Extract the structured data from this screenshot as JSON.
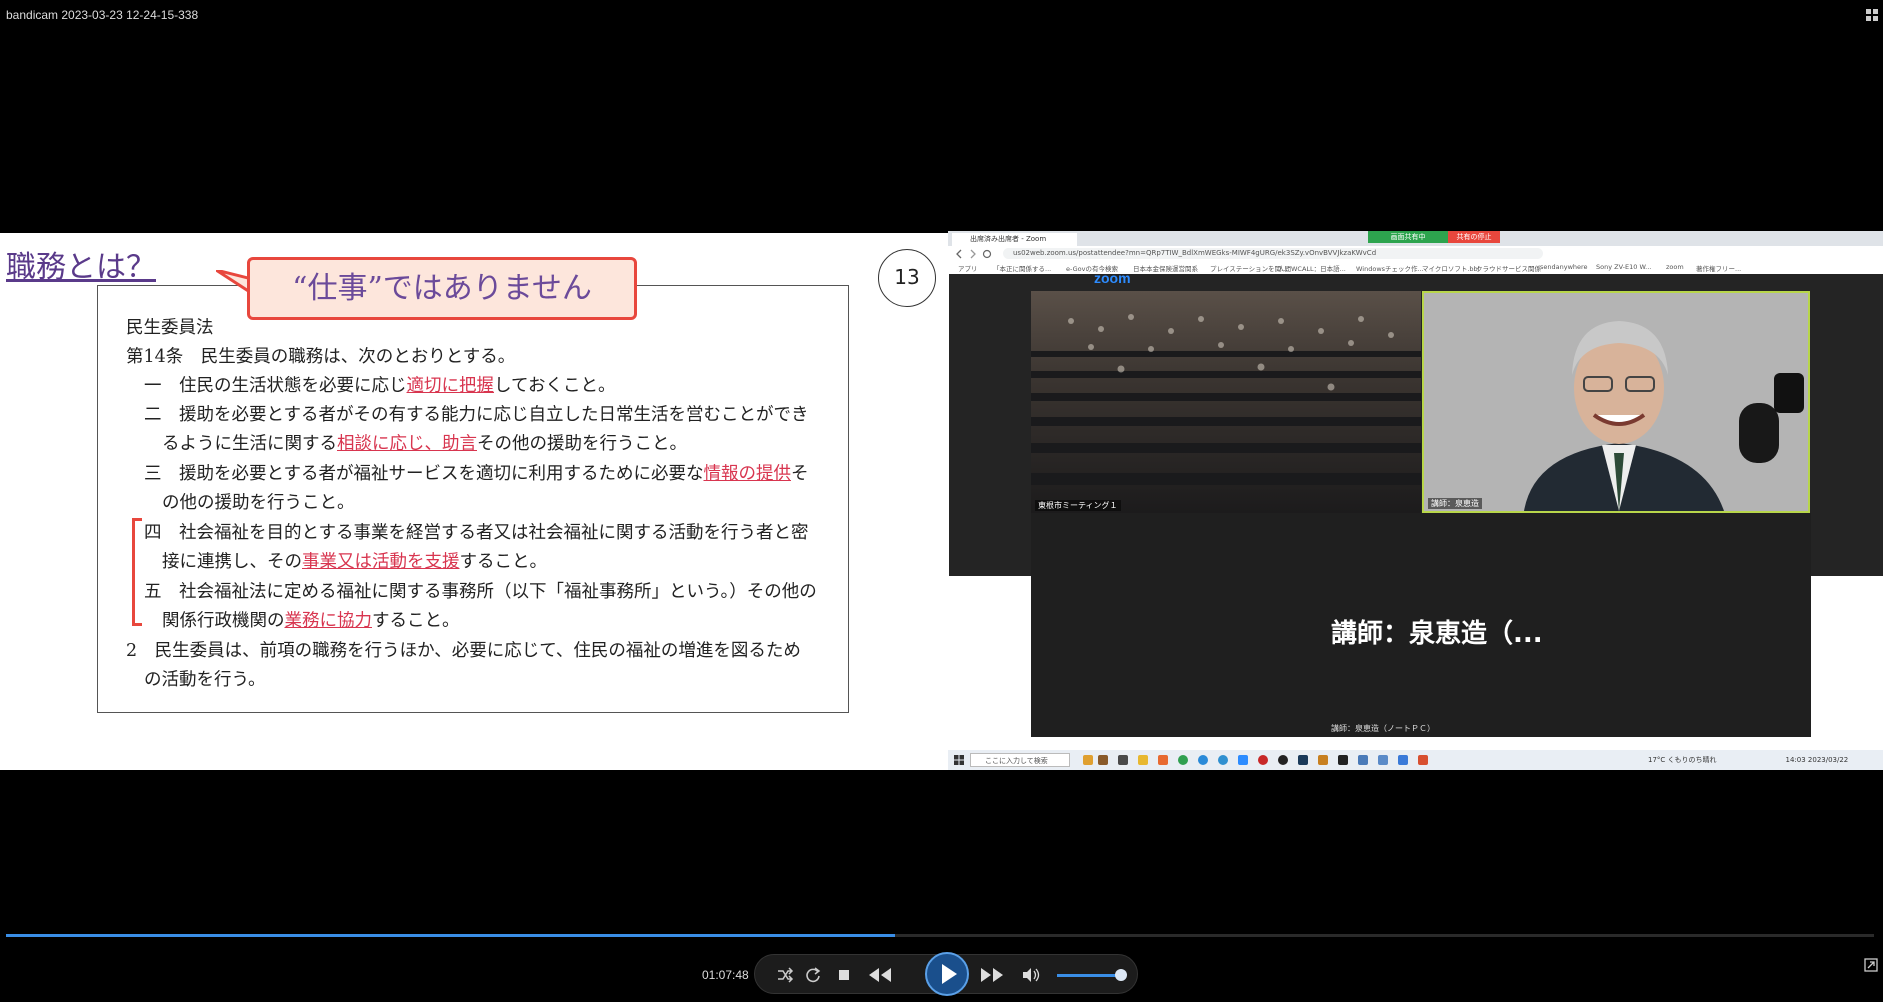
{
  "window": {
    "title": "bandicam 2023-03-23 12-24-15-338"
  },
  "slide": {
    "title": "職務とは？",
    "callout": "“仕事”ではありません",
    "page_number": "13",
    "law": {
      "name": "民生委員法",
      "article": "第14条　民生委員の職務は、次のとおりとする。",
      "item1_pre": "一　住民の生活状態を必要に応じ",
      "item1_hl": "適切に把握",
      "item1_post": "しておくこと。",
      "item2_line1": "二　援助を必要とする者がその有する能力に応じ自立した日常生活を営むことができ",
      "item2_pre": "るように生活に関する",
      "item2_hl": "相談に応じ、助言",
      "item2_post": "その他の援助を行うこと。",
      "item3_pre": "三　援助を必要とする者が福祉サービスを適切に利用するために必要な",
      "item3_hl": "情報の提供",
      "item3_post": "そ",
      "item3_line2": "の他の援助を行うこと。",
      "item4_line1": "四　社会福祉を目的とする事業を経営する者又は社会福祉に関する活動を行う者と密",
      "item4_pre": "接に連携し、その",
      "item4_hl": "事業又は活動を支援",
      "item4_post": "すること。",
      "item5_line1": "五　社会福祉法に定める福祉に関する事務所（以下「福祉事務所」という。）その他の",
      "item5_pre": "関係行政機関の",
      "item5_hl": "業務に協力",
      "item5_post": "すること。",
      "para2_line1": "2　民生委員は、前項の職務を行うほか、必要に応じて、住民の福祉の増進を図るため",
      "para2_line2": "の活動を行う。"
    }
  },
  "zoom": {
    "tab_title": "出席済み出席者 - Zoom",
    "share_badge": "画面共有中",
    "stop_badge": "共有の停止",
    "url": "us02web.zoom.us/postattendee?mn=QRp7TIW_BdlXmWEGks-MIWF4gURG/ek3SZy.vOnvBVVJkzaKWvCd",
    "bookmarks": [
      "アプリ",
      "「本正に関係する...",
      "e-Govの有今検索",
      "日本本金保険運営関系",
      "プレイステーションを関...",
      "人間WCALL：日本語...",
      "Windowsチェック作...",
      "マイクロソフト.bbl",
      "クラウドサービス関係",
      "sendanywhere",
      "Sony ZV-E10 W...",
      "zoom",
      "著作権フリー..."
    ],
    "logo": "zoom",
    "audience_label": "東根市ミーティング１",
    "speaker_label": "講師：泉恵造",
    "lower_name": "講師：泉恵造（...",
    "lower_label": "講師：泉恵造（ノートＰＣ）",
    "taskbar": {
      "search_placeholder": "ここに入力して検索",
      "weather": "17°C くもりのち晴れ",
      "clock": "14:03 2023/03/22"
    }
  },
  "player": {
    "time": "01:07:48",
    "progress": 0.476,
    "volume": 0.85,
    "accent": "#3a8ee6"
  }
}
